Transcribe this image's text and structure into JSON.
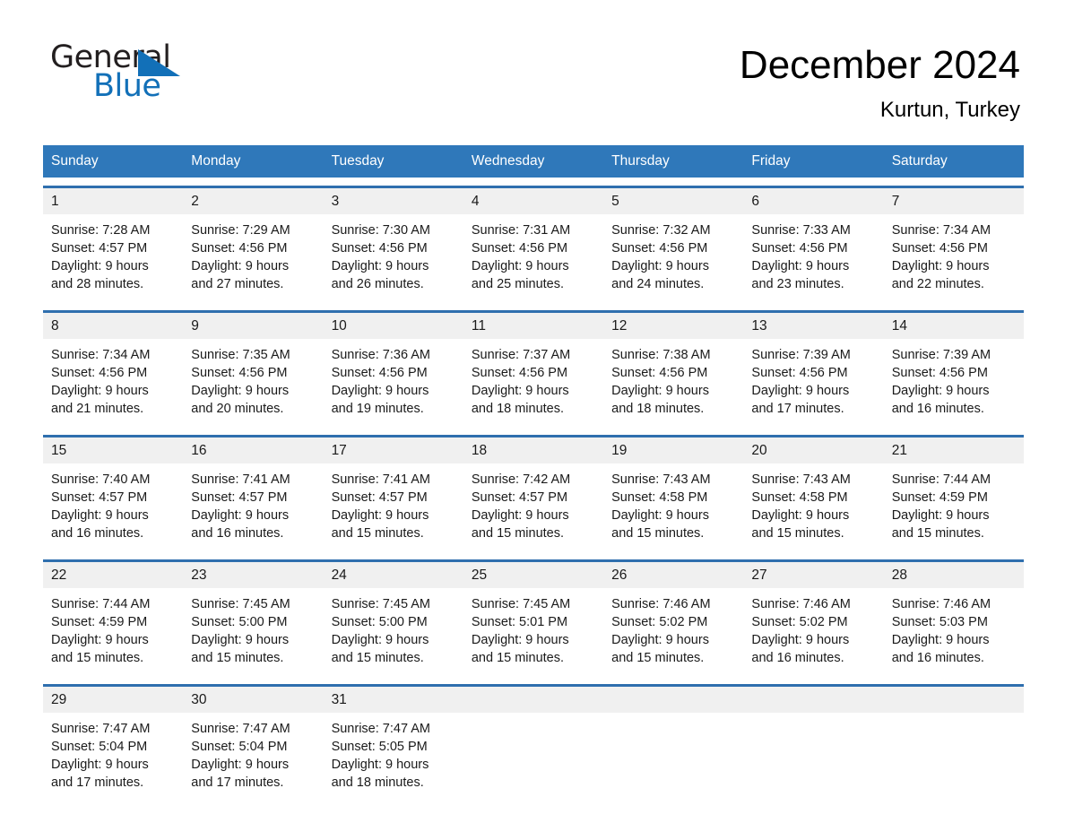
{
  "brand": {
    "name_part1": "General",
    "name_part2": "Blue",
    "accent_color": "#1270b8"
  },
  "header": {
    "month_title": "December 2024",
    "location": "Kurtun, Turkey"
  },
  "theme": {
    "header_bar_color": "#2f78ba",
    "week_divider_color": "#2f6fae",
    "daynum_band_color": "#f0f0f0"
  },
  "calendar": {
    "weekdays": [
      "Sunday",
      "Monday",
      "Tuesday",
      "Wednesday",
      "Thursday",
      "Friday",
      "Saturday"
    ],
    "weeks": [
      {
        "days": [
          {
            "date": "1",
            "sunrise": "Sunrise: 7:28 AM",
            "sunset": "Sunset: 4:57 PM",
            "daylight1": "Daylight: 9 hours",
            "daylight2": "and 28 minutes."
          },
          {
            "date": "2",
            "sunrise": "Sunrise: 7:29 AM",
            "sunset": "Sunset: 4:56 PM",
            "daylight1": "Daylight: 9 hours",
            "daylight2": "and 27 minutes."
          },
          {
            "date": "3",
            "sunrise": "Sunrise: 7:30 AM",
            "sunset": "Sunset: 4:56 PM",
            "daylight1": "Daylight: 9 hours",
            "daylight2": "and 26 minutes."
          },
          {
            "date": "4",
            "sunrise": "Sunrise: 7:31 AM",
            "sunset": "Sunset: 4:56 PM",
            "daylight1": "Daylight: 9 hours",
            "daylight2": "and 25 minutes."
          },
          {
            "date": "5",
            "sunrise": "Sunrise: 7:32 AM",
            "sunset": "Sunset: 4:56 PM",
            "daylight1": "Daylight: 9 hours",
            "daylight2": "and 24 minutes."
          },
          {
            "date": "6",
            "sunrise": "Sunrise: 7:33 AM",
            "sunset": "Sunset: 4:56 PM",
            "daylight1": "Daylight: 9 hours",
            "daylight2": "and 23 minutes."
          },
          {
            "date": "7",
            "sunrise": "Sunrise: 7:34 AM",
            "sunset": "Sunset: 4:56 PM",
            "daylight1": "Daylight: 9 hours",
            "daylight2": "and 22 minutes."
          }
        ]
      },
      {
        "days": [
          {
            "date": "8",
            "sunrise": "Sunrise: 7:34 AM",
            "sunset": "Sunset: 4:56 PM",
            "daylight1": "Daylight: 9 hours",
            "daylight2": "and 21 minutes."
          },
          {
            "date": "9",
            "sunrise": "Sunrise: 7:35 AM",
            "sunset": "Sunset: 4:56 PM",
            "daylight1": "Daylight: 9 hours",
            "daylight2": "and 20 minutes."
          },
          {
            "date": "10",
            "sunrise": "Sunrise: 7:36 AM",
            "sunset": "Sunset: 4:56 PM",
            "daylight1": "Daylight: 9 hours",
            "daylight2": "and 19 minutes."
          },
          {
            "date": "11",
            "sunrise": "Sunrise: 7:37 AM",
            "sunset": "Sunset: 4:56 PM",
            "daylight1": "Daylight: 9 hours",
            "daylight2": "and 18 minutes."
          },
          {
            "date": "12",
            "sunrise": "Sunrise: 7:38 AM",
            "sunset": "Sunset: 4:56 PM",
            "daylight1": "Daylight: 9 hours",
            "daylight2": "and 18 minutes."
          },
          {
            "date": "13",
            "sunrise": "Sunrise: 7:39 AM",
            "sunset": "Sunset: 4:56 PM",
            "daylight1": "Daylight: 9 hours",
            "daylight2": "and 17 minutes."
          },
          {
            "date": "14",
            "sunrise": "Sunrise: 7:39 AM",
            "sunset": "Sunset: 4:56 PM",
            "daylight1": "Daylight: 9 hours",
            "daylight2": "and 16 minutes."
          }
        ]
      },
      {
        "days": [
          {
            "date": "15",
            "sunrise": "Sunrise: 7:40 AM",
            "sunset": "Sunset: 4:57 PM",
            "daylight1": "Daylight: 9 hours",
            "daylight2": "and 16 minutes."
          },
          {
            "date": "16",
            "sunrise": "Sunrise: 7:41 AM",
            "sunset": "Sunset: 4:57 PM",
            "daylight1": "Daylight: 9 hours",
            "daylight2": "and 16 minutes."
          },
          {
            "date": "17",
            "sunrise": "Sunrise: 7:41 AM",
            "sunset": "Sunset: 4:57 PM",
            "daylight1": "Daylight: 9 hours",
            "daylight2": "and 15 minutes."
          },
          {
            "date": "18",
            "sunrise": "Sunrise: 7:42 AM",
            "sunset": "Sunset: 4:57 PM",
            "daylight1": "Daylight: 9 hours",
            "daylight2": "and 15 minutes."
          },
          {
            "date": "19",
            "sunrise": "Sunrise: 7:43 AM",
            "sunset": "Sunset: 4:58 PM",
            "daylight1": "Daylight: 9 hours",
            "daylight2": "and 15 minutes."
          },
          {
            "date": "20",
            "sunrise": "Sunrise: 7:43 AM",
            "sunset": "Sunset: 4:58 PM",
            "daylight1": "Daylight: 9 hours",
            "daylight2": "and 15 minutes."
          },
          {
            "date": "21",
            "sunrise": "Sunrise: 7:44 AM",
            "sunset": "Sunset: 4:59 PM",
            "daylight1": "Daylight: 9 hours",
            "daylight2": "and 15 minutes."
          }
        ]
      },
      {
        "days": [
          {
            "date": "22",
            "sunrise": "Sunrise: 7:44 AM",
            "sunset": "Sunset: 4:59 PM",
            "daylight1": "Daylight: 9 hours",
            "daylight2": "and 15 minutes."
          },
          {
            "date": "23",
            "sunrise": "Sunrise: 7:45 AM",
            "sunset": "Sunset: 5:00 PM",
            "daylight1": "Daylight: 9 hours",
            "daylight2": "and 15 minutes."
          },
          {
            "date": "24",
            "sunrise": "Sunrise: 7:45 AM",
            "sunset": "Sunset: 5:00 PM",
            "daylight1": "Daylight: 9 hours",
            "daylight2": "and 15 minutes."
          },
          {
            "date": "25",
            "sunrise": "Sunrise: 7:45 AM",
            "sunset": "Sunset: 5:01 PM",
            "daylight1": "Daylight: 9 hours",
            "daylight2": "and 15 minutes."
          },
          {
            "date": "26",
            "sunrise": "Sunrise: 7:46 AM",
            "sunset": "Sunset: 5:02 PM",
            "daylight1": "Daylight: 9 hours",
            "daylight2": "and 15 minutes."
          },
          {
            "date": "27",
            "sunrise": "Sunrise: 7:46 AM",
            "sunset": "Sunset: 5:02 PM",
            "daylight1": "Daylight: 9 hours",
            "daylight2": "and 16 minutes."
          },
          {
            "date": "28",
            "sunrise": "Sunrise: 7:46 AM",
            "sunset": "Sunset: 5:03 PM",
            "daylight1": "Daylight: 9 hours",
            "daylight2": "and 16 minutes."
          }
        ]
      },
      {
        "days": [
          {
            "date": "29",
            "sunrise": "Sunrise: 7:47 AM",
            "sunset": "Sunset: 5:04 PM",
            "daylight1": "Daylight: 9 hours",
            "daylight2": "and 17 minutes."
          },
          {
            "date": "30",
            "sunrise": "Sunrise: 7:47 AM",
            "sunset": "Sunset: 5:04 PM",
            "daylight1": "Daylight: 9 hours",
            "daylight2": "and 17 minutes."
          },
          {
            "date": "31",
            "sunrise": "Sunrise: 7:47 AM",
            "sunset": "Sunset: 5:05 PM",
            "daylight1": "Daylight: 9 hours",
            "daylight2": "and 18 minutes."
          },
          {
            "date": "",
            "sunrise": "",
            "sunset": "",
            "daylight1": "",
            "daylight2": ""
          },
          {
            "date": "",
            "sunrise": "",
            "sunset": "",
            "daylight1": "",
            "daylight2": ""
          },
          {
            "date": "",
            "sunrise": "",
            "sunset": "",
            "daylight1": "",
            "daylight2": ""
          },
          {
            "date": "",
            "sunrise": "",
            "sunset": "",
            "daylight1": "",
            "daylight2": ""
          }
        ]
      }
    ]
  }
}
